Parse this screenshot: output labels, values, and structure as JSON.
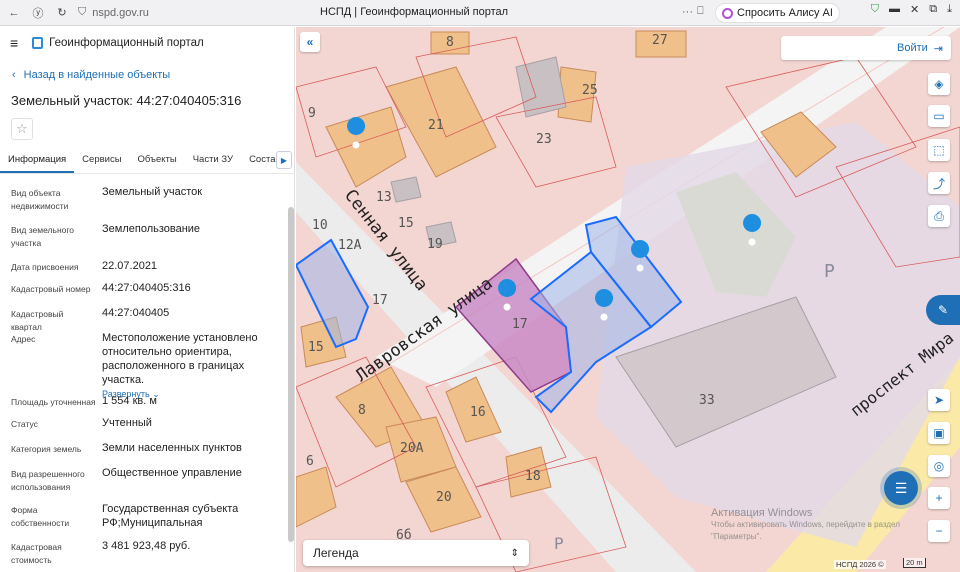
{
  "browser": {
    "url": "nspd.gov.ru",
    "tab_title": "НСПД | Геоинформационный портал",
    "alice_label": "Спросить Алису AI"
  },
  "header": {
    "portal_name": "Геоинформационный портал"
  },
  "back_link": "Назад в найденные объекты",
  "object_title": "Земельный участок: 44:27:040405:316",
  "tabs": [
    "Информация",
    "Сервисы",
    "Объекты",
    "Части ЗУ",
    "Состав"
  ],
  "props": [
    {
      "label": "Вид объекта недвижимости",
      "value": "Земельный участок"
    },
    {
      "label": "Вид земельного участка",
      "value": "Землепользование"
    },
    {
      "label": "Дата присвоения",
      "value": "22.07.2021"
    },
    {
      "label": "Кадастровый номер",
      "value": "44:27:040405:316"
    },
    {
      "label": "Кадастровый квартал",
      "value": "44:27:040405"
    },
    {
      "label": "Адрес",
      "value": "Местоположение установлено относительно ориентира, расположенного в границах участка."
    },
    {
      "label": "Площадь уточненная",
      "value": "1 554 кв. м"
    },
    {
      "label": "Статус",
      "value": "Учтенный"
    },
    {
      "label": "Категория земель",
      "value": "Земли населенных пунктов"
    },
    {
      "label": "Вид разрешенного использования",
      "value": "Общественное управление"
    },
    {
      "label": "Форма собственности",
      "value": "Государственная субъекта РФ;Муниципальная"
    },
    {
      "label": "Кадастровая стоимость",
      "value": "3 481 923,48 руб."
    }
  ],
  "expand_label": "Развернуть",
  "map": {
    "login_label": "Войти",
    "legend_label": "Легенда",
    "watermark_line1": "Активация Windows",
    "watermark_line2": "Чтобы активировать Windows, перейдите в раздел",
    "watermark_line3": "\"Параметры\".",
    "copyright": "НСПД 2026 ©",
    "scale": "20 m",
    "streets": [
      "Сенная улица",
      "Лавровская улица",
      "проспект Мира"
    ],
    "building_labels": [
      "8",
      "27",
      "9",
      "25",
      "21",
      "23",
      "13",
      "10",
      "15",
      "19",
      "12А",
      "17",
      "15",
      "17",
      "8",
      "16",
      "20А",
      "6",
      "18",
      "20",
      "6б",
      "33",
      "P",
      "P"
    ],
    "colors": {
      "accent": "#1e6fb5",
      "building": "#f0c08a",
      "selected": "#c98bc6",
      "parcel_blue": "#1a6cff",
      "green": "#b7d98c"
    }
  }
}
